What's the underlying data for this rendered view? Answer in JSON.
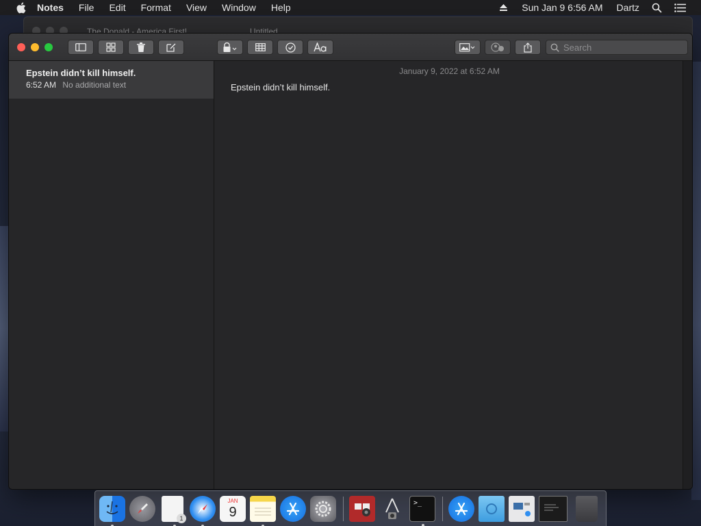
{
  "menubar": {
    "app_name": "Notes",
    "items": [
      "File",
      "Edit",
      "Format",
      "View",
      "Window",
      "Help"
    ],
    "clock": "Sun Jan 9  6:56 AM",
    "user": "Dartz"
  },
  "background_window": {
    "tab1": "The Donald - America First!",
    "tab2": "Untitled"
  },
  "toolbar": {
    "search_placeholder": "Search"
  },
  "notes_list": [
    {
      "title": "Epstein didn’t kill himself.",
      "time": "6:52 AM",
      "preview": "No additional text"
    }
  ],
  "editor": {
    "date": "January 9, 2022 at 6:52 AM",
    "body": "Epstein didn’t kill himself."
  },
  "dock": {
    "calendar_month": "JAN",
    "calendar_day": "9",
    "pages_badge": "1"
  },
  "colors": {
    "close": "#fe5f57",
    "minimize": "#febc2e",
    "zoom": "#28c840",
    "selected_row": "#3a3a3c",
    "window_bg": "#262628"
  }
}
